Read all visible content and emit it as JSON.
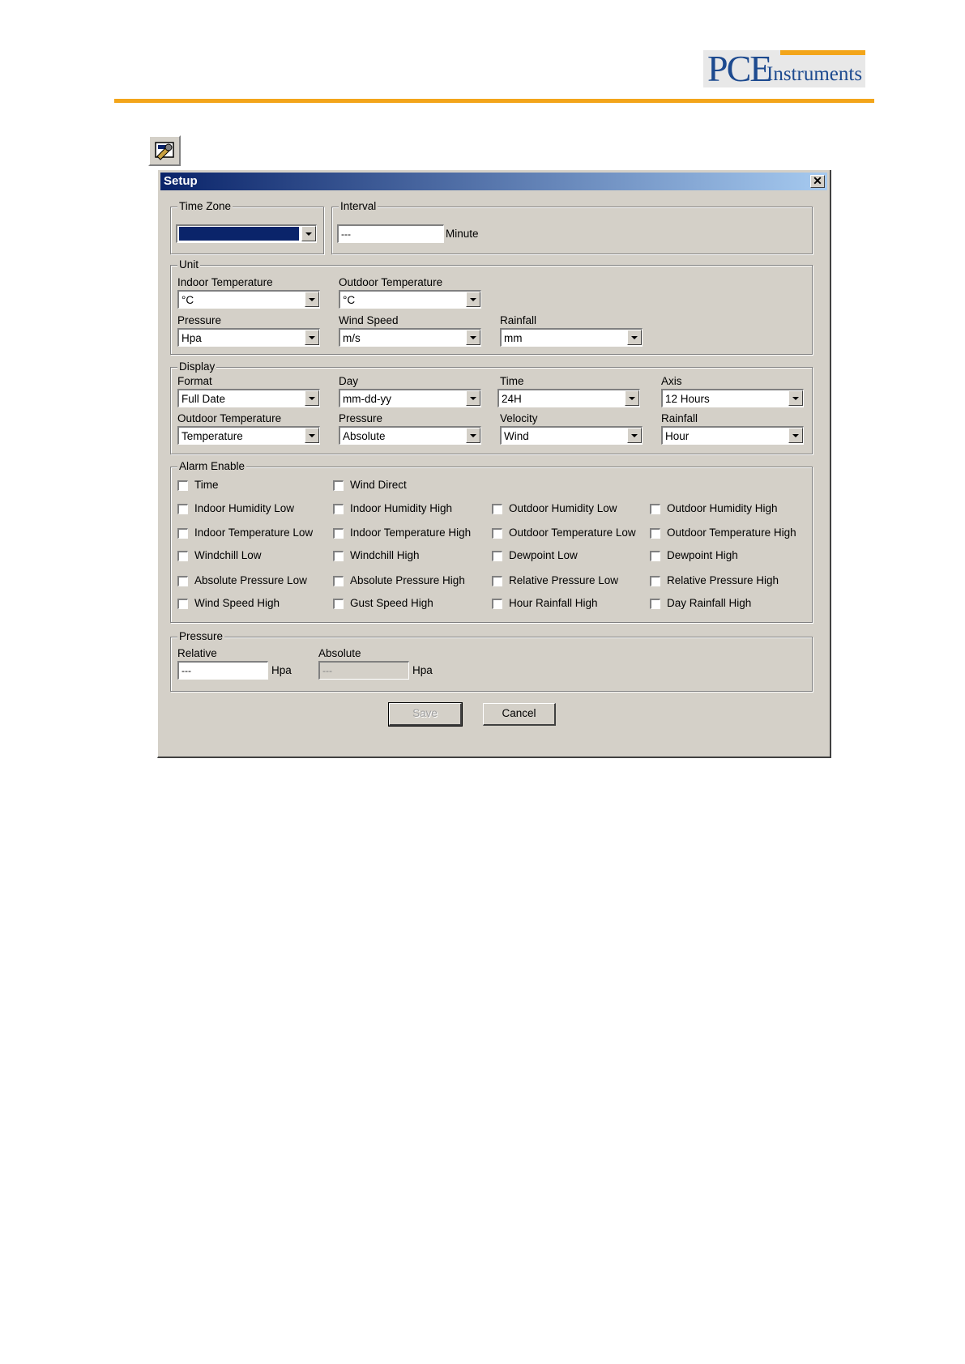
{
  "logo": {
    "brand": "PCE",
    "suffix": "Instruments"
  },
  "toolbar_icon": "setup-icon",
  "dialog": {
    "title": "Setup",
    "close_label": "✕",
    "time_zone": {
      "legend": "Time Zone",
      "value": ""
    },
    "interval": {
      "legend": "Interval",
      "value": "---",
      "unit": "Minute"
    },
    "unit": {
      "legend": "Unit",
      "indoor_temperature": {
        "label": "Indoor Temperature",
        "value": "°C"
      },
      "outdoor_temperature": {
        "label": "Outdoor Temperature",
        "value": "°C"
      },
      "pressure": {
        "label": "Pressure",
        "value": "Hpa"
      },
      "wind_speed": {
        "label": "Wind Speed",
        "value": "m/s"
      },
      "rainfall": {
        "label": "Rainfall",
        "value": "mm"
      }
    },
    "display": {
      "legend": "Display",
      "format": {
        "label": "Format",
        "value": "Full Date"
      },
      "day": {
        "label": "Day",
        "value": "mm-dd-yy"
      },
      "time": {
        "label": "Time",
        "value": "24H"
      },
      "axis": {
        "label": "Axis",
        "value": "12 Hours"
      },
      "outdoor_temperature": {
        "label": "Outdoor Temperature",
        "value": "Temperature"
      },
      "pressure": {
        "label": "Pressure",
        "value": "Absolute"
      },
      "velocity": {
        "label": "Velocity",
        "value": "Wind"
      },
      "rainfall": {
        "label": "Rainfall",
        "value": "Hour"
      }
    },
    "alarm": {
      "legend": "Alarm Enable",
      "items": [
        "Time",
        "Wind Direct",
        "Indoor Humidity Low",
        "Indoor Humidity High",
        "Outdoor Humidity Low",
        "Outdoor Humidity High",
        "Indoor Temperature Low",
        "Indoor Temperature High",
        "Outdoor Temperature Low",
        "Outdoor Temperature High",
        "Windchill Low",
        "Windchill High",
        "Dewpoint Low",
        "Dewpoint High",
        "Absolute Pressure Low",
        "Absolute Pressure High",
        "Relative Pressure Low",
        "Relative Pressure High",
        "Wind Speed High",
        "Gust Speed High",
        "Hour Rainfall High",
        "Day Rainfall High"
      ]
    },
    "pressure": {
      "legend": "Pressure",
      "relative": {
        "label": "Relative",
        "value": "---",
        "unit": "Hpa"
      },
      "absolute": {
        "label": "Absolute",
        "value": "---",
        "unit": "Hpa"
      }
    },
    "save_label": "Save",
    "cancel_label": "Cancel"
  }
}
